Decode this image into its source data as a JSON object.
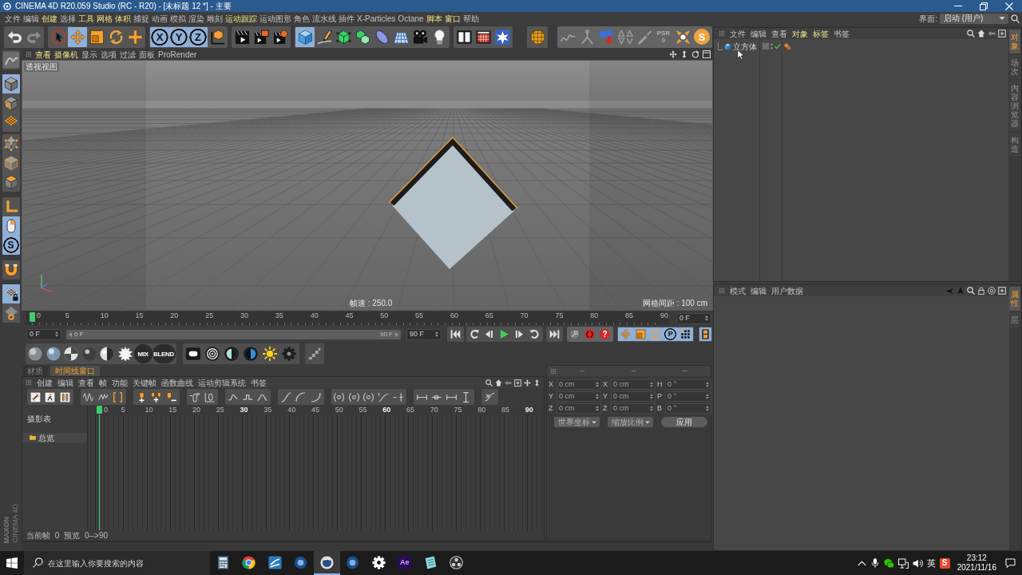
{
  "window": {
    "title": "CINEMA 4D R20.059 Studio (RC - R20) - [未标题 12 *] - 主要"
  },
  "menu_bar": {
    "items": [
      {
        "label": "文件",
        "highlighted": false
      },
      {
        "label": "编辑",
        "highlighted": false
      },
      {
        "label": "创建",
        "highlighted": true
      },
      {
        "label": "选择",
        "highlighted": false
      },
      {
        "label": "工具",
        "highlighted": true
      },
      {
        "label": "网格",
        "highlighted": true
      },
      {
        "label": "体积",
        "highlighted": true
      },
      {
        "label": "捕捉",
        "highlighted": false
      },
      {
        "label": "动画",
        "highlighted": false
      },
      {
        "label": "模拟",
        "highlighted": false
      },
      {
        "label": "渲染",
        "highlighted": false
      },
      {
        "label": "雕刻",
        "highlighted": false
      },
      {
        "label": "运动跟踪",
        "highlighted": true
      },
      {
        "label": "运动图形",
        "highlighted": false
      },
      {
        "label": "角色",
        "highlighted": false
      },
      {
        "label": "流水线",
        "highlighted": false
      },
      {
        "label": "插件",
        "highlighted": false
      },
      {
        "label": "X-Particles",
        "highlighted": false
      },
      {
        "label": "Octane",
        "highlighted": false
      },
      {
        "label": "脚本",
        "highlighted": true
      },
      {
        "label": "窗口",
        "highlighted": true
      },
      {
        "label": "帮助",
        "highlighted": false
      }
    ],
    "layout_label": "界面:",
    "layout_value": "启动 (用户)"
  },
  "main_toolbar": [
    [
      {
        "kind": "icon",
        "selected": false
      },
      {
        "kind": "icon",
        "selected": false
      }
    ],
    [
      {
        "kind": "icon",
        "selected": false
      },
      {
        "kind": "icon",
        "selected": true
      },
      {
        "kind": "icon",
        "selected": false
      },
      {
        "kind": "icon",
        "selected": false
      },
      {
        "kind": "icon",
        "selected": false
      }
    ],
    [
      {
        "kind": "letter",
        "label": "X",
        "selected": true
      },
      {
        "kind": "letter",
        "label": "Y",
        "selected": true
      },
      {
        "kind": "letter",
        "label": "Z",
        "selected": true
      },
      {
        "kind": "icon",
        "selected": false
      }
    ],
    [
      {
        "kind": "icon",
        "selected": false
      },
      {
        "kind": "icon",
        "selected": false
      },
      {
        "kind": "icon",
        "selected": false
      }
    ],
    [
      {
        "kind": "icon",
        "selected": true
      },
      {
        "kind": "icon",
        "selected": false
      },
      {
        "kind": "icon",
        "selected": false
      },
      {
        "kind": "icon",
        "selected": false
      },
      {
        "kind": "icon",
        "selected": false
      },
      {
        "kind": "icon",
        "selected": false
      },
      {
        "kind": "icon",
        "selected": false
      },
      {
        "kind": "icon",
        "selected": false
      }
    ],
    [
      {
        "kind": "icon",
        "selected": false
      },
      {
        "kind": "icon",
        "selected": false
      },
      {
        "kind": "icon",
        "selected": false
      }
    ],
    [
      {
        "kind": "icon",
        "selected": false
      }
    ],
    [
      {
        "kind": "icon",
        "selected": false
      },
      {
        "kind": "icon",
        "selected": false
      },
      {
        "kind": "icon",
        "selected": false
      },
      {
        "kind": "icon",
        "selected": false
      },
      {
        "kind": "icon",
        "selected": false
      },
      {
        "kind": "stack",
        "label": "PSR",
        "sub": "0",
        "selected": false
      },
      {
        "kind": "icon",
        "selected": false
      },
      {
        "kind": "logo",
        "label": "S",
        "selected": false
      }
    ]
  ],
  "left_toolbar": [
    [
      {
        "kind": "icon",
        "selected": false
      }
    ],
    [
      {
        "kind": "icon",
        "selected": true
      },
      {
        "kind": "icon",
        "selected": false
      },
      {
        "kind": "icon",
        "selected": false
      }
    ],
    [
      {
        "kind": "icon",
        "selected": false
      },
      {
        "kind": "icon",
        "selected": false
      },
      {
        "kind": "icon",
        "selected": false
      }
    ],
    [
      {
        "kind": "icon",
        "selected": false
      },
      {
        "kind": "icon",
        "selected": true
      },
      {
        "kind": "letter",
        "label": "S",
        "selected": true
      }
    ],
    [
      {
        "kind": "icon",
        "selected": false
      }
    ],
    [
      {
        "kind": "icon",
        "selected": true
      },
      {
        "kind": "icon",
        "selected": false
      }
    ]
  ],
  "brand": {
    "maxon": "MAXON",
    "product": "CINEMA 4D"
  },
  "viewport": {
    "menu": [
      {
        "label": "查看",
        "highlighted": true
      },
      {
        "label": "摄像机",
        "highlighted": true
      },
      {
        "label": "显示",
        "highlighted": false
      },
      {
        "label": "选项",
        "highlighted": false
      },
      {
        "label": "过滤",
        "highlighted": false
      },
      {
        "label": "面板",
        "highlighted": false
      },
      {
        "label": "ProRender",
        "highlighted": false
      }
    ],
    "view_name": "透视视图",
    "fps": "帧速 : 250.0",
    "grid_spacing": "网格间距 : 100 cm"
  },
  "timeline": {
    "ruler": {
      "ticks": [
        "0",
        "5",
        "10",
        "15",
        "20",
        "25",
        "30",
        "35",
        "40",
        "45",
        "50",
        "55",
        "60",
        "65",
        "70",
        "75",
        "80",
        "85",
        "90"
      ],
      "level": 0
    },
    "current_frame": "0 F",
    "start_field": "0 F",
    "range": {
      "start": "0 F",
      "end": "90 F",
      "level": 1
    },
    "end_field": "90 F",
    "transport": [
      [
        {
          "kind": "icon",
          "selected": false
        }
      ],
      [
        {
          "kind": "icon",
          "selected": false
        },
        {
          "kind": "icon",
          "selected": false
        },
        {
          "kind": "icon",
          "selected": false
        },
        {
          "kind": "icon",
          "selected": false
        },
        {
          "kind": "icon",
          "selected": false
        }
      ],
      [
        {
          "kind": "icon",
          "selected": false
        }
      ],
      [
        {
          "kind": "icon",
          "selected": false
        },
        {
          "kind": "icon",
          "selected": false
        },
        {
          "kind": "badge",
          "label": "?",
          "selected": false
        }
      ],
      [
        {
          "kind": "icon",
          "selected": true
        },
        {
          "kind": "icon",
          "selected": true
        },
        {
          "kind": "icon",
          "selected": true
        },
        {
          "kind": "letter",
          "label": "P",
          "selected": true
        },
        {
          "kind": "icon",
          "selected": true
        }
      ],
      [
        {
          "kind": "icon",
          "selected": true
        }
      ]
    ]
  },
  "material_toolbar": {
    "mix_label": "MIX",
    "blend_label": "BLEND"
  },
  "bottom_tabs": [
    {
      "label": "材质",
      "selected": false
    },
    {
      "label": "时间线窗口",
      "selected": true
    }
  ],
  "timeline_window": {
    "menu": [
      "创建",
      "编辑",
      "查看",
      "帧",
      "功能",
      "关键帧",
      "函数曲线",
      "运动剪辑系统",
      "书签"
    ],
    "track_header": "摄影表",
    "ruler": {
      "ticks": [
        {
          "label": "0",
          "major": false
        },
        {
          "label": "5",
          "major": false
        },
        {
          "label": "10",
          "major": false
        },
        {
          "label": "15",
          "major": false
        },
        {
          "label": "20",
          "major": false
        },
        {
          "label": "25",
          "major": false
        },
        {
          "label": "30",
          "major": true
        },
        {
          "label": "35",
          "major": false
        },
        {
          "label": "40",
          "major": false
        },
        {
          "label": "45",
          "major": false
        },
        {
          "label": "50",
          "major": false
        },
        {
          "label": "55",
          "major": false
        },
        {
          "label": "60",
          "major": true
        },
        {
          "label": "65",
          "major": false
        },
        {
          "label": "70",
          "major": false
        },
        {
          "label": "75",
          "major": false
        },
        {
          "label": "80",
          "major": false
        },
        {
          "label": "85",
          "major": false
        },
        {
          "label": "90",
          "major": true
        }
      ],
      "level": 0
    },
    "tracks": [
      {
        "label": "总览",
        "selected": false
      }
    ],
    "status": "当前帧 0 预览 0-->90"
  },
  "coordinates": {
    "disabled": true,
    "headers": [
      "--",
      "--",
      "--"
    ],
    "columns": [
      [
        {
          "axis": "X",
          "value": "0 cm"
        },
        {
          "axis": "Y",
          "value": "0 cm"
        },
        {
          "axis": "Z",
          "value": "0 cm"
        }
      ],
      [
        {
          "axis": "X",
          "value": "0 cm"
        },
        {
          "axis": "Y",
          "value": "0 cm"
        },
        {
          "axis": "Z",
          "value": "0 cm"
        }
      ],
      [
        {
          "axis": "H",
          "value": "0 °"
        },
        {
          "axis": "P",
          "value": "0 °"
        },
        {
          "axis": "B",
          "value": "0 °"
        }
      ]
    ],
    "coordinate_mode": "世界坐标",
    "size_mode": "缩放比例",
    "apply_button": "应用"
  },
  "object_manager": {
    "menu": [
      {
        "label": "文件",
        "highlighted": false
      },
      {
        "label": "编辑",
        "highlighted": false
      },
      {
        "label": "查看",
        "highlighted": false
      },
      {
        "label": "对象",
        "highlighted": true
      },
      {
        "label": "标签",
        "highlighted": true
      },
      {
        "label": "书签",
        "highlighted": false
      }
    ],
    "objects": [
      {
        "name": "立方体",
        "selected": false,
        "enabled": true
      }
    ],
    "side_tabs": [
      {
        "label": "对象",
        "selected": true
      },
      {
        "label": "场次",
        "selected": false
      },
      {
        "label": "内容浏览器",
        "selected": false
      },
      {
        "label": "构造",
        "selected": false
      }
    ]
  },
  "attribute_manager": {
    "menu": [
      "模式",
      "编辑",
      "用户数据"
    ],
    "side_tabs": [
      {
        "label": "属性",
        "selected": true
      },
      {
        "label": "层",
        "selected": false
      }
    ]
  },
  "taskbar": {
    "search_placeholder": "在这里输入你要搜索的内容",
    "apps": [
      {
        "kind": "icon",
        "selected": false
      },
      {
        "kind": "icon",
        "selected": false
      },
      {
        "kind": "icon",
        "selected": false
      },
      {
        "kind": "icon",
        "selected": false
      },
      {
        "kind": "icon",
        "selected": true
      },
      {
        "kind": "icon",
        "selected": false
      },
      {
        "kind": "icon",
        "selected": false
      },
      {
        "kind": "letter",
        "label": "Ae",
        "selected": false
      },
      {
        "kind": "icon",
        "selected": false
      },
      {
        "kind": "icon",
        "selected": false
      }
    ],
    "ime": "英",
    "ime_logo": "S",
    "time": "23:12",
    "date": "2021/11/16"
  }
}
